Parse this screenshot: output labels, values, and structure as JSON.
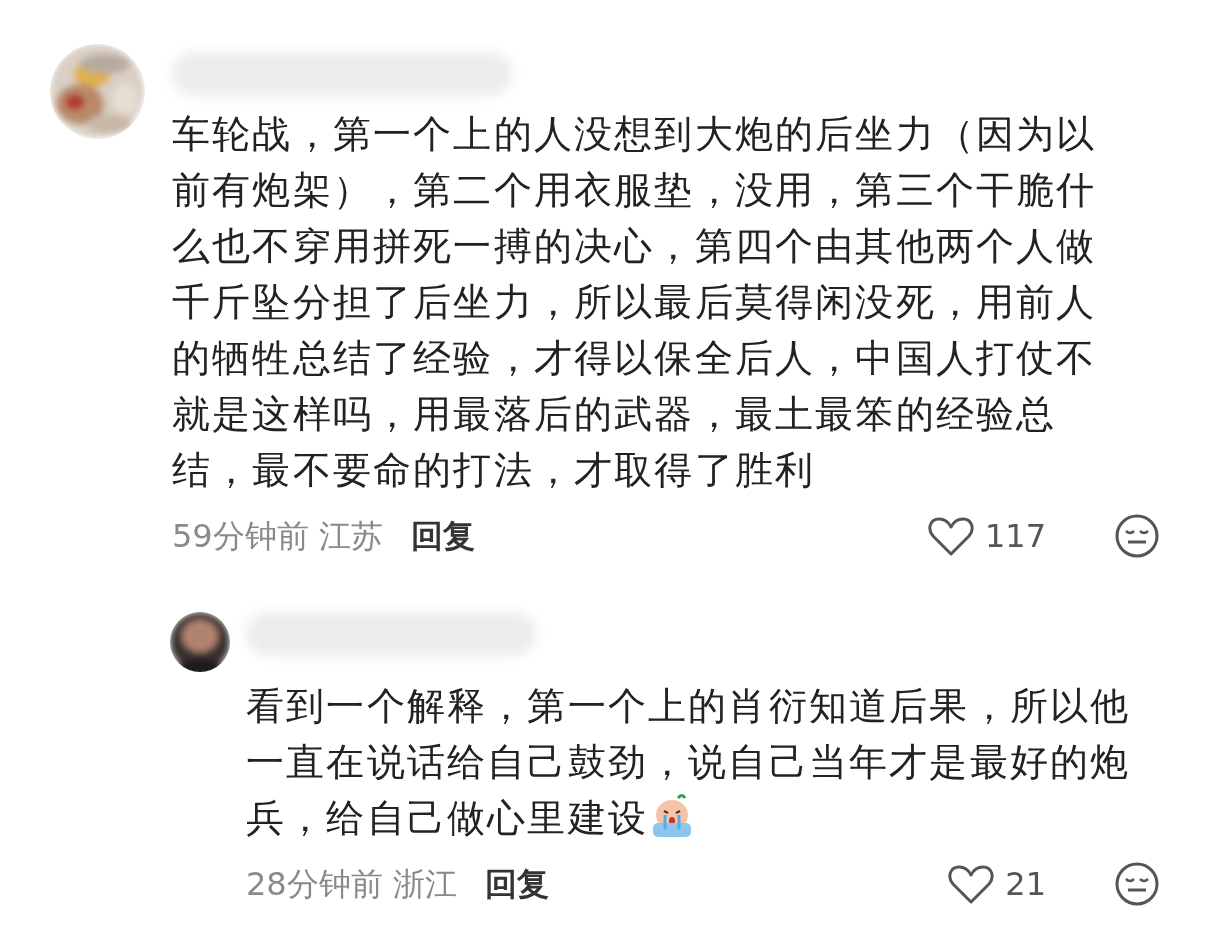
{
  "comments": [
    {
      "text": "车轮战，第一个上的人没想到大炮的后坐力（因为以前有炮架），第二个用衣服垫，没用，第三个干脆什么也不穿用拼死一搏的决心，第四个由其他两个人做千斤坠分担了后坐力，所以最后莫得闲没死，用前人的牺牲总结了经验，才得以保全后人，中国人打仗不就是这样吗，用最落后的武器，最土最笨的经验总结，最不要命的打法，才取得了胜利",
      "time": "59分钟前",
      "location": "江苏",
      "reply_label": "回复",
      "likes": "117",
      "replies": [
        {
          "text": "看到一个解释，第一个上的肖衍知道后果，所以他一直在说话给自己鼓劲，说自己当年才是最好的炮兵，给自己做心里建设",
          "sticker": true,
          "time": "28分钟前",
          "location": "浙江",
          "reply_label": "回复",
          "likes": "21"
        }
      ]
    }
  ]
}
